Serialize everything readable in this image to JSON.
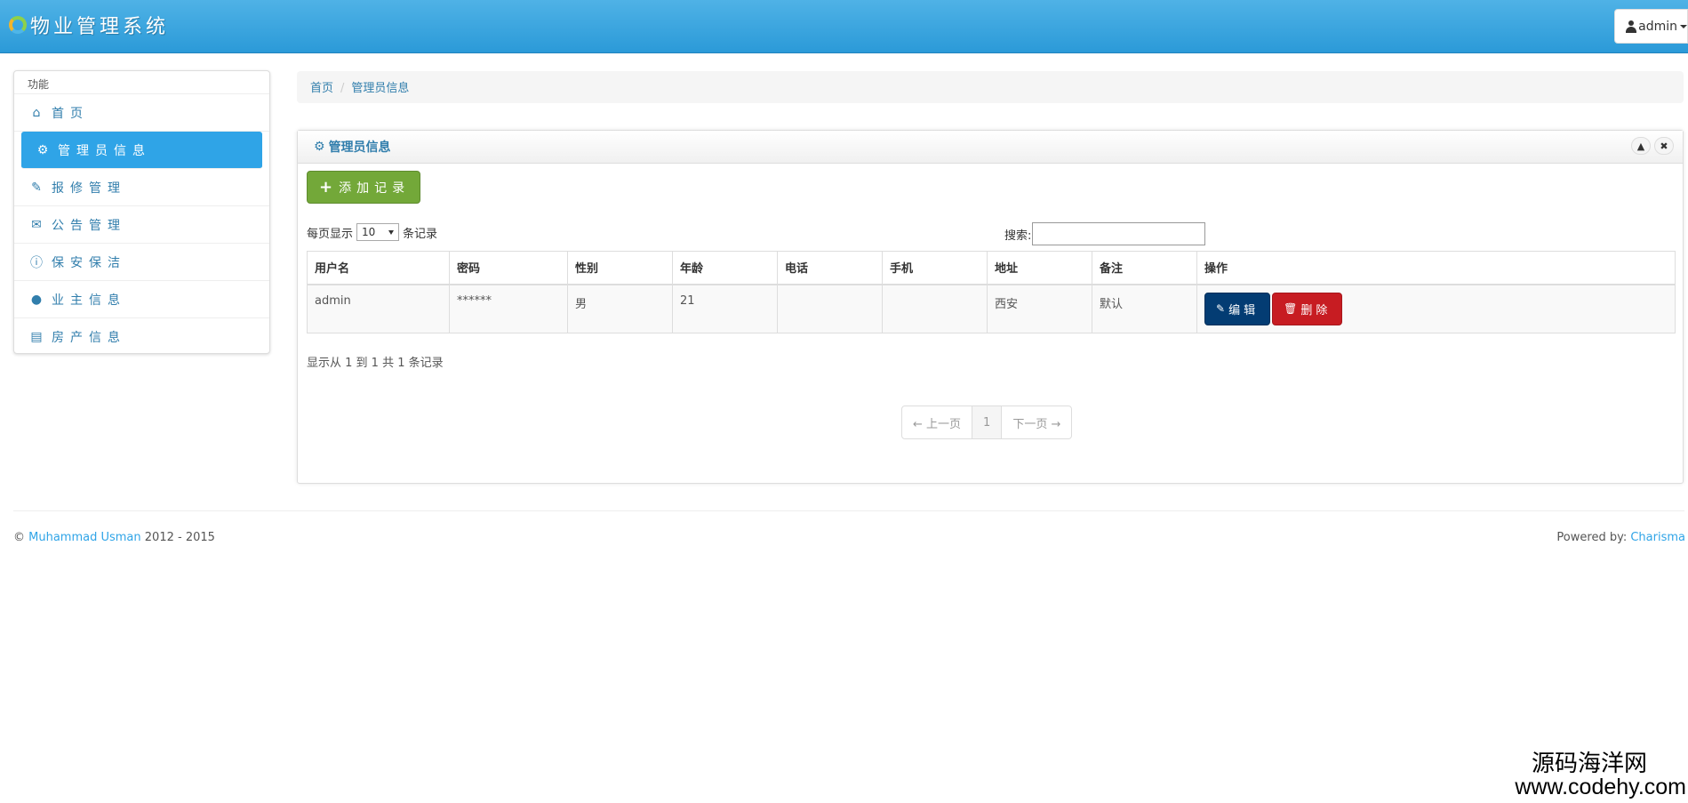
{
  "header": {
    "title": "物业管理系统",
    "user_label": "admin"
  },
  "sidebar": {
    "title": "功能",
    "items": [
      {
        "label": "首页",
        "icon": "home-icon"
      },
      {
        "label": "管理员信息",
        "icon": "gear-icon",
        "active": true
      },
      {
        "label": "报修管理",
        "icon": "wrench-icon"
      },
      {
        "label": "公告管理",
        "icon": "envelope-icon"
      },
      {
        "label": "保安保洁",
        "icon": "info-icon"
      },
      {
        "label": "业主信息",
        "icon": "user-icon"
      },
      {
        "label": "房产信息",
        "icon": "list-icon"
      }
    ]
  },
  "breadcrumb": {
    "home": "首页",
    "current": "管理员信息"
  },
  "panel": {
    "title": "管理员信息",
    "add_button": "添加记录",
    "length_prefix": "每页显示",
    "length_value": "10",
    "length_suffix": "条记录",
    "search_label": "搜索:",
    "search_value": ""
  },
  "table": {
    "columns": [
      "用户名",
      "密码",
      "性别",
      "年龄",
      "电话",
      "手机",
      "地址",
      "备注",
      "操作"
    ],
    "rows": [
      {
        "username": "admin",
        "password": "******",
        "gender": "男",
        "age": "21",
        "phone": "",
        "mobile": "",
        "address": "西安",
        "note": "默认",
        "edit": "编辑",
        "delete": "删除"
      }
    ]
  },
  "info_text": "显示从 1 到 1 共 1 条记录",
  "pagination": {
    "prev": "← 上一页",
    "page": "1",
    "next": "下一页 →"
  },
  "footer": {
    "copyright": "©",
    "author": "Muhammad Usman",
    "years": "2012 - 2015",
    "powered_label": "Powered by:",
    "powered_link": "Charisma"
  },
  "watermark": {
    "line1": "源码海洋网",
    "line2": "www.codehy.com"
  },
  "colors": {
    "navbar": "#2fa4e7",
    "active_nav": "#2fa4e7",
    "add_button": "#73a839",
    "edit_button": "#033c73",
    "delete_button": "#c71c22",
    "link": "#317eac"
  }
}
